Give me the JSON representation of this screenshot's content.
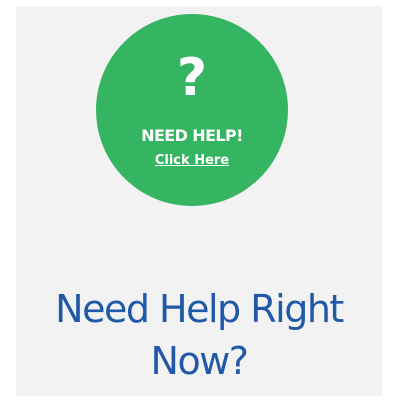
{
  "help_badge": {
    "icon": "question-mark-icon",
    "icon_glyph": "?",
    "title": "NEED HELP!",
    "link_label": "Click Here",
    "color": "#35b461"
  },
  "heading": {
    "text": "Need Help Right Now?",
    "color": "#2159a8"
  },
  "colors": {
    "panel_background": "#f2f2f2",
    "page_background": "#ffffff"
  }
}
